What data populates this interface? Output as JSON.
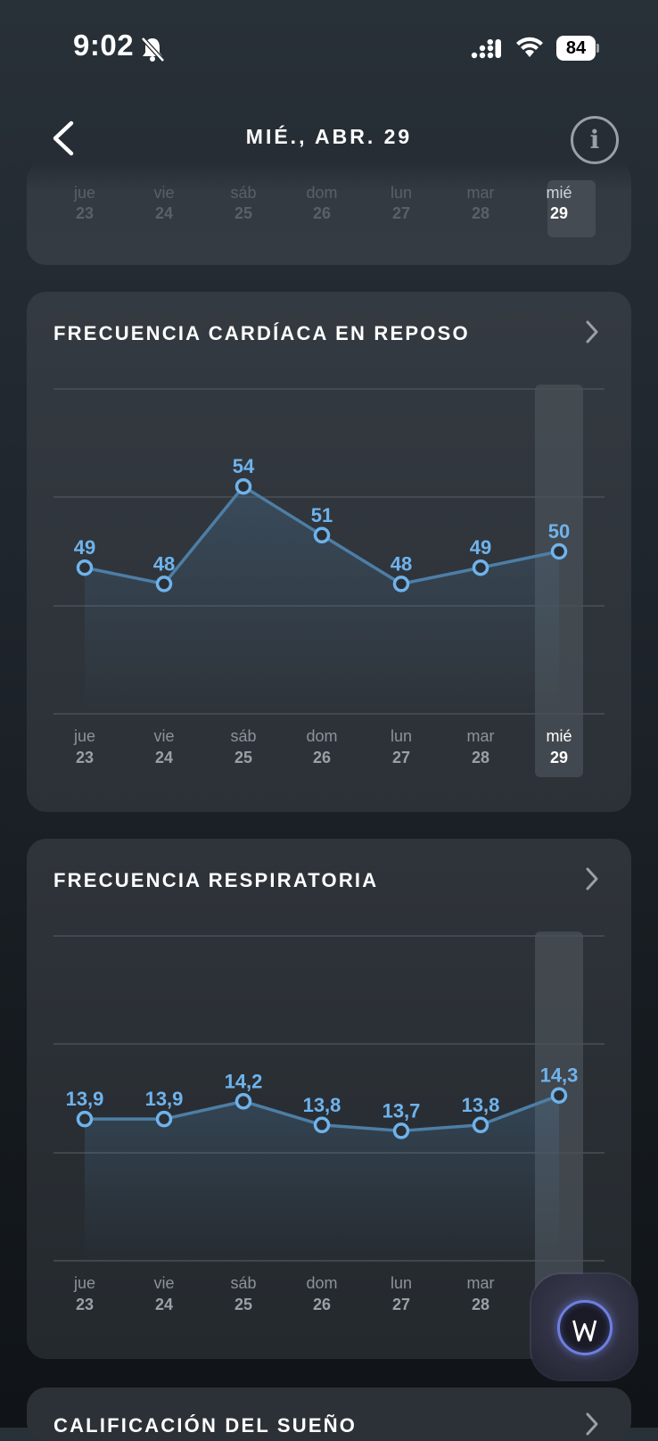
{
  "status_bar": {
    "time": "9:02",
    "battery": "84"
  },
  "header": {
    "title": "MIÉ., ABR. 29",
    "info_label": "i"
  },
  "days": [
    {
      "name": "jue",
      "num": "23"
    },
    {
      "name": "vie",
      "num": "24"
    },
    {
      "name": "sáb",
      "num": "25"
    },
    {
      "name": "dom",
      "num": "26"
    },
    {
      "name": "lun",
      "num": "27"
    },
    {
      "name": "mar",
      "num": "28"
    },
    {
      "name": "mié",
      "num": "29"
    }
  ],
  "selected_day_index": 6,
  "resting_hr": {
    "title": "FRECUENCIA CARDÍACA EN REPOSO"
  },
  "respiratory": {
    "title": "FRECUENCIA RESPIRATORIA"
  },
  "sleep": {
    "title": "CALIFICACIÓN DEL SUEÑO"
  },
  "colors": {
    "accent": "#6fb3ec",
    "line": "#4d7ea6",
    "card": "#30363d"
  },
  "chart_data": [
    {
      "type": "line",
      "title": "FRECUENCIA CARDÍACA EN REPOSO",
      "categories": [
        "jue 23",
        "vie 24",
        "sáb 25",
        "dom 26",
        "lun 27",
        "mar 28",
        "mié 29"
      ],
      "values": [
        49,
        48,
        54,
        51,
        48,
        49,
        50
      ],
      "labels": [
        "49",
        "48",
        "54",
        "51",
        "48",
        "49",
        "50"
      ],
      "ylim": [
        40,
        60
      ],
      "grid": true
    },
    {
      "type": "line",
      "title": "FRECUENCIA RESPIRATORIA",
      "categories": [
        "jue 23",
        "vie 24",
        "sáb 25",
        "dom 26",
        "lun 27",
        "mar 28",
        "mié 29"
      ],
      "values": [
        13.9,
        13.9,
        14.2,
        13.8,
        13.7,
        13.8,
        14.3
      ],
      "labels": [
        "13,9",
        "13,9",
        "14,2",
        "13,8",
        "13,7",
        "13,8",
        "14,3"
      ],
      "ylim": [
        11.5,
        17.0
      ],
      "grid": true
    }
  ]
}
